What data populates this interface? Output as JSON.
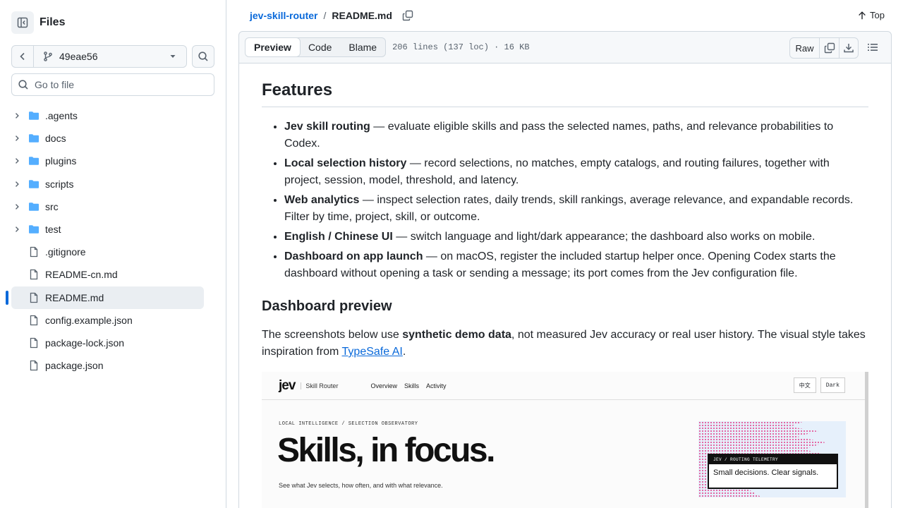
{
  "sidebar": {
    "title": "Files",
    "branch": "49eae56",
    "goto_placeholder": "Go to file",
    "items": [
      {
        "label": ".agents",
        "type": "folder"
      },
      {
        "label": "docs",
        "type": "folder"
      },
      {
        "label": "plugins",
        "type": "folder"
      },
      {
        "label": "scripts",
        "type": "folder"
      },
      {
        "label": "src",
        "type": "folder"
      },
      {
        "label": "test",
        "type": "folder"
      },
      {
        "label": ".gitignore",
        "type": "file"
      },
      {
        "label": "README-cn.md",
        "type": "file"
      },
      {
        "label": "README.md",
        "type": "file",
        "active": true
      },
      {
        "label": "config.example.json",
        "type": "file"
      },
      {
        "label": "package-lock.json",
        "type": "file"
      },
      {
        "label": "package.json",
        "type": "file"
      }
    ]
  },
  "breadcrumb": {
    "repo": "jev-skill-router",
    "separator": "/",
    "file": "README.md",
    "top_label": "Top"
  },
  "file_header": {
    "tabs": [
      "Preview",
      "Code",
      "Blame"
    ],
    "active_tab": "Preview",
    "meta": "206 lines (137 loc) · 16 KB",
    "raw_label": "Raw"
  },
  "readme": {
    "features_heading": "Features",
    "features": [
      {
        "title": "Jev skill routing",
        "text": " — evaluate eligible skills and pass the selected names, paths, and relevance probabilities to Codex."
      },
      {
        "title": "Local selection history",
        "text": " — record selections, no matches, empty catalogs, and routing failures, together with project, session, model, threshold, and latency."
      },
      {
        "title": "Web analytics",
        "text": " — inspect selection rates, daily trends, skill rankings, average relevance, and expandable records. Filter by time, project, skill, or outcome."
      },
      {
        "title": "English / Chinese UI",
        "text": " — switch language and light/dark appearance; the dashboard also works on mobile."
      },
      {
        "title": "Dashboard on app launch",
        "text": " — on macOS, register the included startup helper once. Opening Codex starts the dashboard without opening a task or sending a message; its port comes from the Jev configuration file."
      }
    ],
    "dashboard_heading": "Dashboard preview",
    "intro_before": "The screenshots below use ",
    "intro_bold": "synthetic demo data",
    "intro_mid": ", not measured Jev accuracy or real user history. The visual style takes inspiration from ",
    "intro_link": "TypeSafe AI",
    "intro_after": "."
  },
  "preview_image": {
    "logo": "jev",
    "subtitle": "Skill Router",
    "nav": [
      "Overview",
      "Skills",
      "Activity"
    ],
    "lang_button": "中文",
    "theme_button": "Dark",
    "kicker": "LOCAL INTELLIGENCE / SELECTION OBSERVATORY",
    "headline": "Skills, in focus.",
    "tagline": "See what Jev selects, how often, and with what relevance.",
    "card_label": "JEV / ROUTING TELEMETRY",
    "card_text": "Small decisions. Clear signals."
  },
  "colors": {
    "accent": "#0969da",
    "border": "#d1d9e0",
    "folder": "#54aeff",
    "muted": "#59636e",
    "dot_pink": "#e4468e"
  }
}
